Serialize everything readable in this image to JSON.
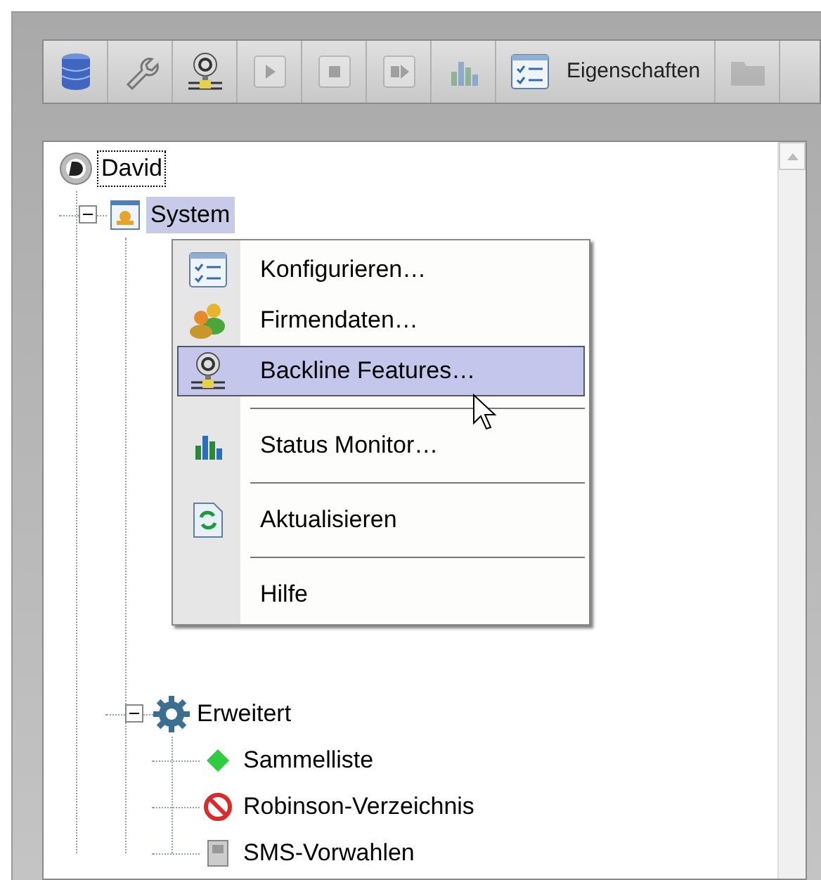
{
  "toolbar": {
    "buttons": [
      {
        "kind": "database",
        "disabled": false
      },
      {
        "kind": "wrench",
        "disabled": false
      },
      {
        "kind": "backline",
        "disabled": false
      },
      {
        "kind": "play",
        "disabled": true
      },
      {
        "kind": "stop",
        "disabled": true
      },
      {
        "kind": "step",
        "disabled": true
      },
      {
        "kind": "chart",
        "disabled": true
      },
      {
        "kind": "properties",
        "label": "Eigenschaften",
        "disabled": false
      },
      {
        "kind": "folder",
        "disabled": true
      }
    ]
  },
  "tree": [
    {
      "label": "David",
      "kind": "root",
      "focused": true,
      "selected": false,
      "children": [
        {
          "label": "System",
          "kind": "system",
          "focused": false,
          "selected": true,
          "expanded": true,
          "children": [
            {
              "label": "Erweitert",
              "kind": "gear",
              "focused": false,
              "selected": false,
              "expanded": true,
              "children": [
                {
                  "label": "Sammelliste",
                  "kind": "diamond",
                  "focused": false,
                  "selected": false
                },
                {
                  "label": "Robinson-Verzeichnis",
                  "kind": "forbidden",
                  "focused": false,
                  "selected": false
                },
                {
                  "label": "SMS-Vorwahlen",
                  "kind": "sms",
                  "focused": false,
                  "selected": false
                }
              ]
            }
          ]
        }
      ]
    }
  ],
  "context_menu": {
    "items": [
      {
        "kind": "configure",
        "label": "Konfigurieren…",
        "selected": false
      },
      {
        "kind": "company",
        "label": "Firmendaten…",
        "selected": false
      },
      {
        "kind": "backline",
        "label": "Backline Features…",
        "selected": true
      },
      {
        "kind": "separator"
      },
      {
        "kind": "monitor",
        "label": "Status Monitor…",
        "selected": false
      },
      {
        "kind": "separator"
      },
      {
        "kind": "refresh",
        "label": "Aktualisieren",
        "selected": false
      },
      {
        "kind": "separator"
      },
      {
        "kind": "help",
        "label": "Hilfe",
        "selected": false
      }
    ]
  }
}
